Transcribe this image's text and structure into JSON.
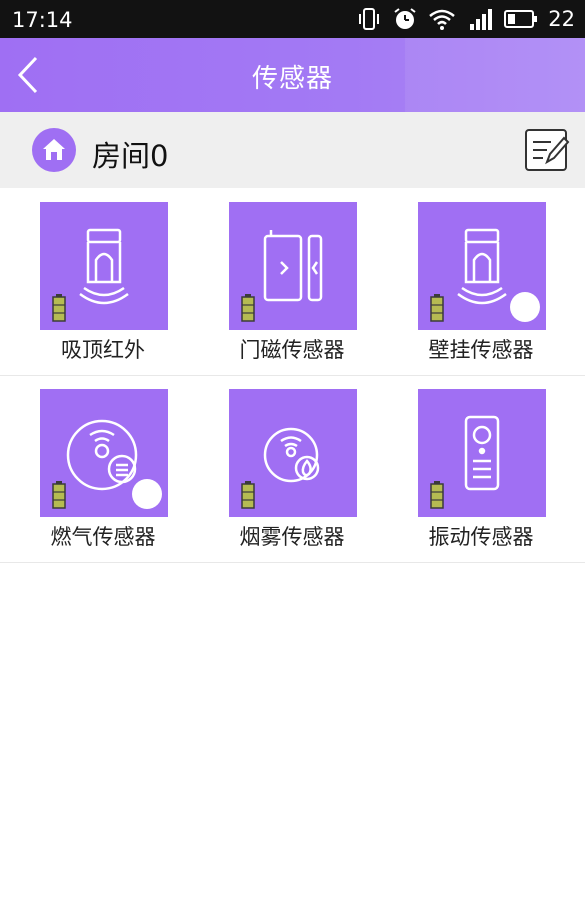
{
  "status_bar": {
    "time": "17:14",
    "battery_level": "22"
  },
  "header": {
    "title": "传感器"
  },
  "room": {
    "name": "房间0"
  },
  "sensors": [
    {
      "label": "吸顶红外",
      "icon": "ceiling-infrared-sensor-icon"
    },
    {
      "label": "门磁传感器",
      "icon": "door-magnet-sensor-icon"
    },
    {
      "label": "壁挂传感器",
      "icon": "wall-mounted-sensor-icon"
    },
    {
      "label": "燃气传感器",
      "icon": "gas-sensor-icon"
    },
    {
      "label": "烟雾传感器",
      "icon": "smoke-sensor-icon"
    },
    {
      "label": "振动传感器",
      "icon": "vibration-sensor-icon"
    }
  ],
  "colors": {
    "accent": "#a06ff3",
    "header_start": "#9f6ff3",
    "battery": "#b5bb52"
  }
}
